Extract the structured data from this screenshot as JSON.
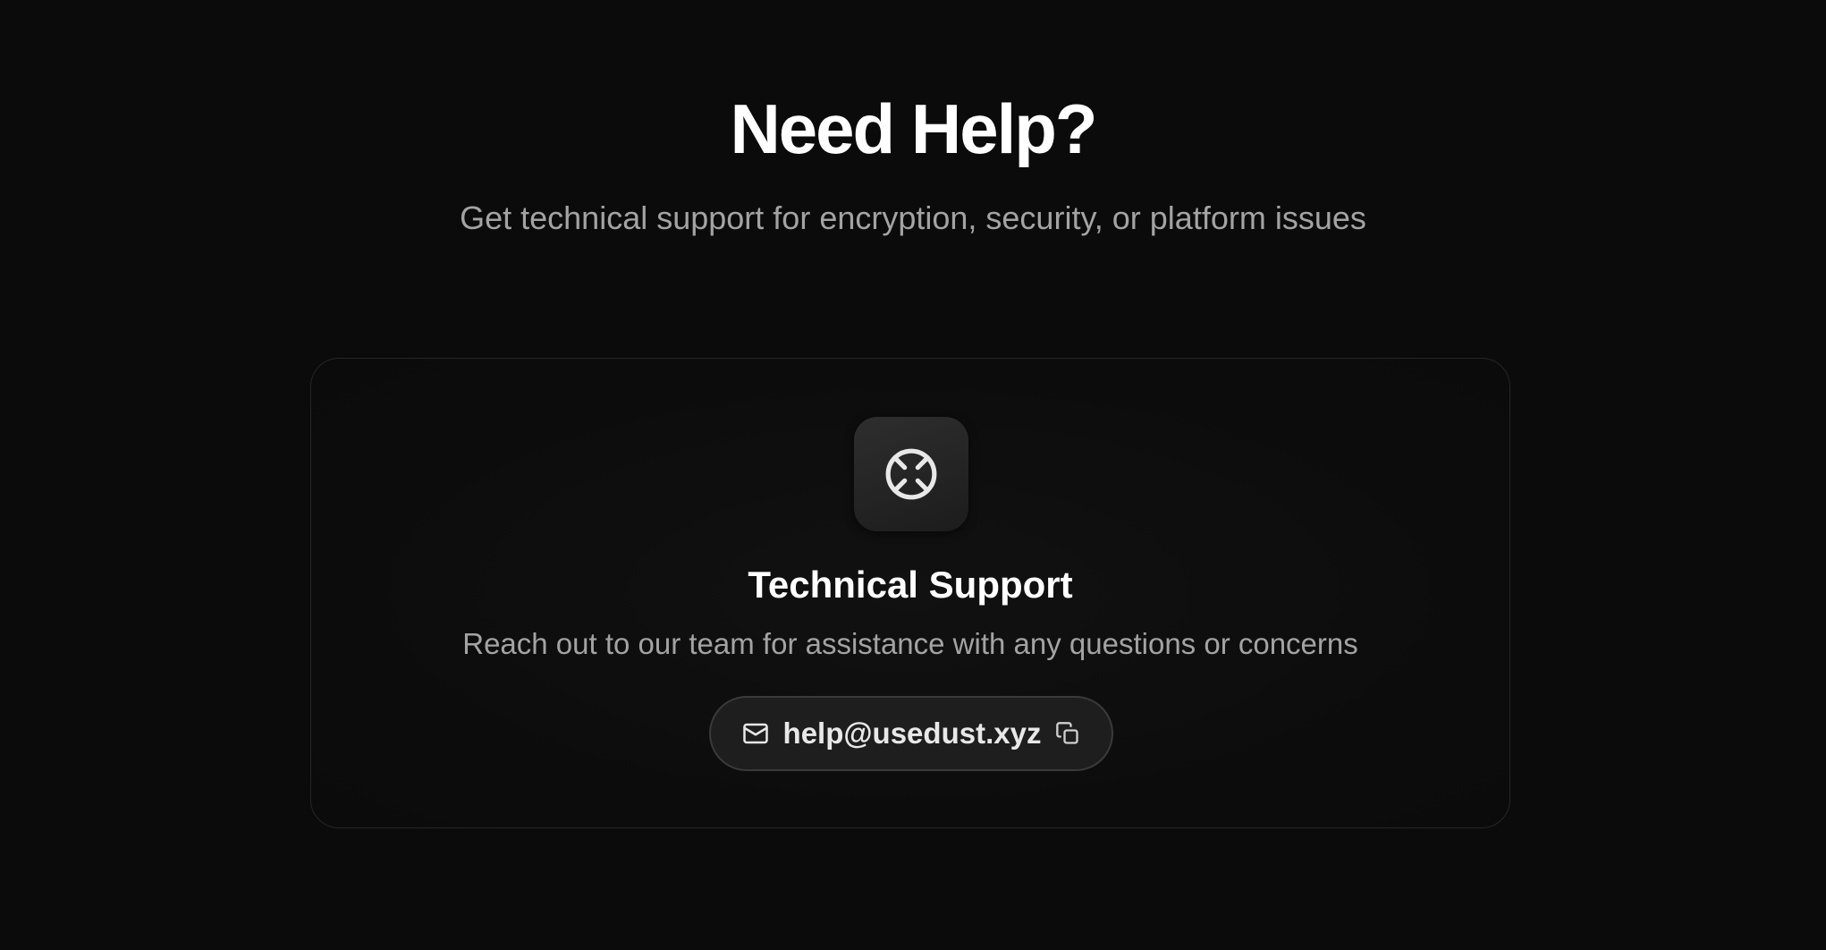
{
  "hero": {
    "title": "Need Help?",
    "subtitle": "Get technical support for encryption, security, or platform issues"
  },
  "support_card": {
    "icon": "lifebuoy-icon",
    "title": "Technical Support",
    "description": "Reach out to our team for assistance with any questions or concerns",
    "email": "help@usedust.xyz",
    "email_icon": "mail-icon",
    "copy_icon": "copy-icon"
  },
  "colors": {
    "background": "#0b0b0b",
    "text_primary": "#ffffff",
    "text_secondary": "#a3a3a3",
    "card_border": "#262626",
    "pill_background": "#1e1e1e"
  }
}
